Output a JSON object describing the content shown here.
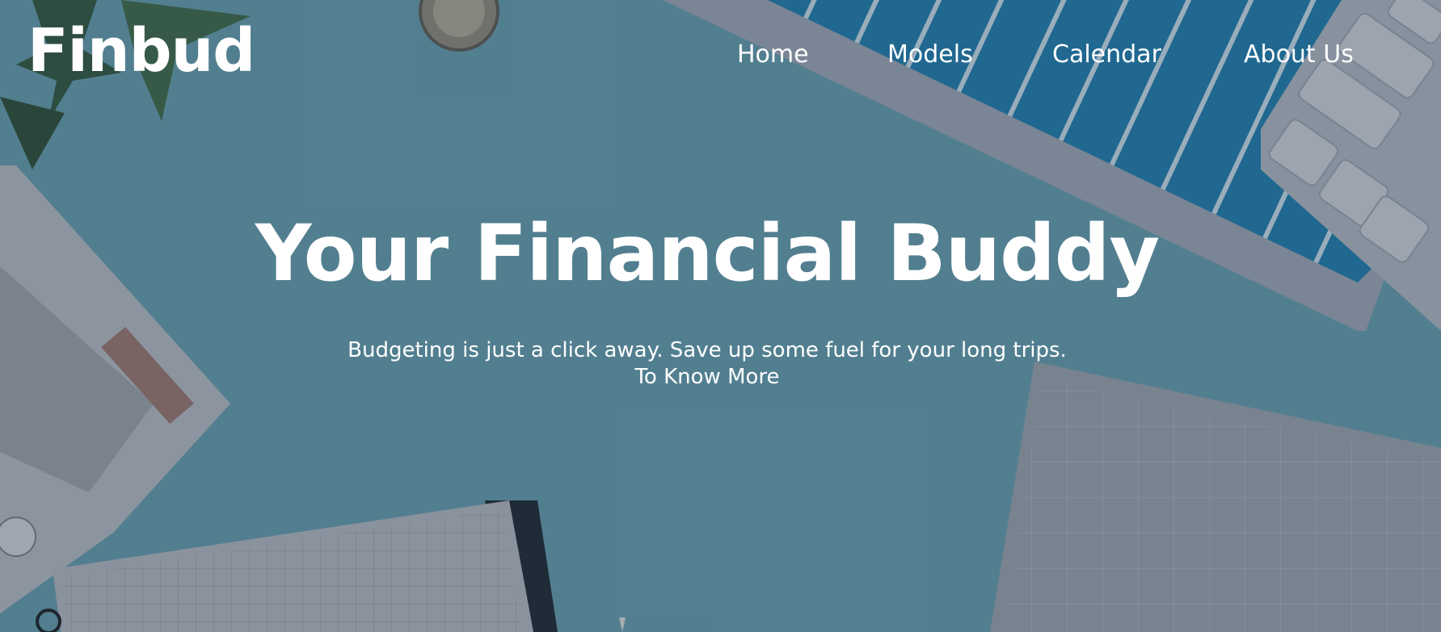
{
  "brand": {
    "logo_text": "Finbud"
  },
  "nav": {
    "items": [
      {
        "label": "Home"
      },
      {
        "label": "Models"
      },
      {
        "label": "Calendar"
      },
      {
        "label": "About Us"
      }
    ]
  },
  "hero": {
    "headline": "Your Financial Buddy",
    "subtitle": "Budgeting is just a click away. Save up some fuel for your long trips.",
    "cta_label": "To Know More"
  },
  "colors": {
    "background": "#5e8a99",
    "text": "#ffffff",
    "accent_blue": "#1e6f9c"
  }
}
